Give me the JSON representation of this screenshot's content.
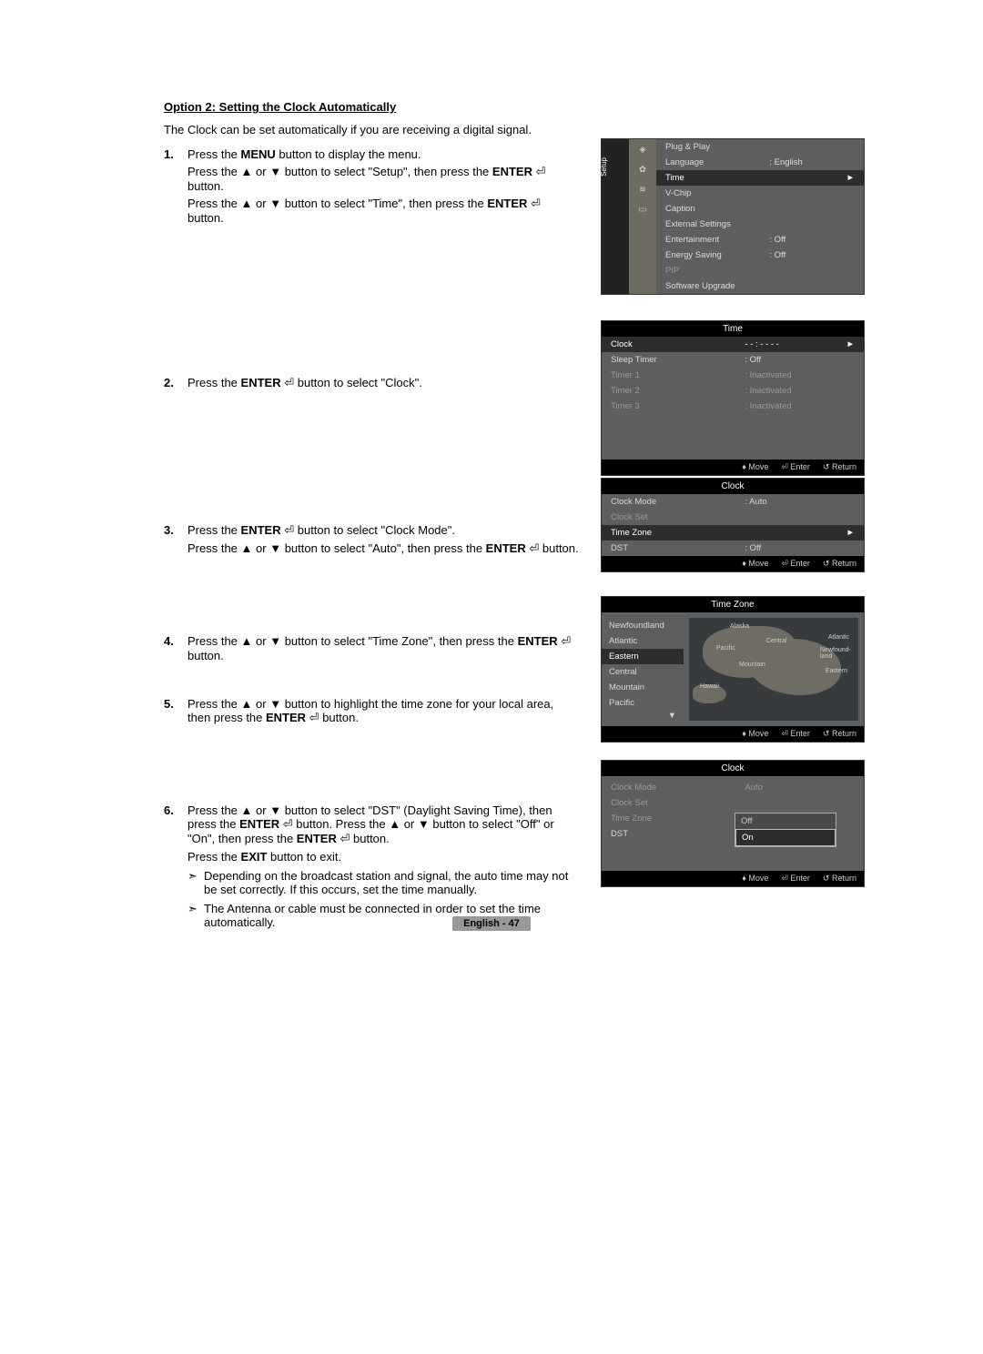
{
  "title": "Option 2: Setting the Clock Automatically",
  "intro": "The Clock can be set automatically if you are receiving a digital signal.",
  "bold": {
    "menu": "MENU",
    "enter": "ENTER",
    "exit": "EXIT"
  },
  "glyph": {
    "up": "▲",
    "down": "▼",
    "updown": "♦",
    "enter_icon": "⏎",
    "return_icon": "↺",
    "arrow_r": "►",
    "note": "➣"
  },
  "steps": {
    "1": {
      "a_pre": "Press the ",
      "a_post": " button to display the menu.",
      "b_pre": "Press the ",
      "b_mid": " or ",
      "b_mid2": " button to select \"Setup\", then press the ",
      "b_post": " button.",
      "c_pre": "Press the ",
      "c_mid": " or ",
      "c_mid2": " button to select \"Time\", then press the ",
      "c_post": " button."
    },
    "2": {
      "pre": "Press the ",
      "post": " button to select \"Clock\"."
    },
    "3": {
      "a_pre": "Press the ",
      "a_post": " button to select \"Clock Mode\".",
      "b_pre": "Press the ",
      "b_mid": " or ",
      "b_mid2": " button to select \"Auto\", then press the ",
      "b_post": " button."
    },
    "4": {
      "pre": "Press the ",
      "mid": " or ",
      "mid2": " button to select \"Time Zone\", then press the ",
      "post": " button."
    },
    "5": {
      "pre": "Press the ",
      "mid": " or ",
      "mid2": " button to highlight the time zone for your local area, then press the ",
      "post": " button."
    },
    "6": {
      "a_pre": "Press the ",
      "a_mid": " or ",
      "a_mid2": " button to select \"DST\" (Daylight Saving Time), then press the ",
      "a_mid3": " button. Press the ",
      "a_mid4": " or ",
      "a_mid5": " button to select \"Off\" or \"On\", then press the ",
      "a_post": " button.",
      "b_pre": "Press the ",
      "b_post": " button to exit.",
      "note1": "Depending on the broadcast station and signal, the auto time may not be set correctly. If this occurs, set the time manually.",
      "note2": "The Antenna or cable must be connected in order to set the time automatically."
    }
  },
  "osd_setup": {
    "sidebar_label": "Setup",
    "items": [
      {
        "label": "Plug & Play",
        "val": ""
      },
      {
        "label": "Language",
        "val": ": English"
      },
      {
        "label": "Time",
        "val": "",
        "sel": true,
        "arrow": true
      },
      {
        "label": "V-Chip",
        "val": ""
      },
      {
        "label": "Caption",
        "val": ""
      },
      {
        "label": "External Settings",
        "val": ""
      },
      {
        "label": "Entertainment",
        "val": ": Off"
      },
      {
        "label": "Energy Saving",
        "val": ": Off"
      },
      {
        "label": "PIP",
        "val": "",
        "dim": true
      },
      {
        "label": "Software Upgrade",
        "val": ""
      }
    ]
  },
  "osd_time": {
    "title": "Time",
    "items": [
      {
        "label": "Clock",
        "val": "- - : - - - -",
        "sel": true,
        "arrow": true
      },
      {
        "label": "Sleep Timer",
        "val": ": Off"
      },
      {
        "label": "Timer 1",
        "val": ": Inactivated",
        "dim": true
      },
      {
        "label": "Timer 2",
        "val": ": Inactivated",
        "dim": true
      },
      {
        "label": "Timer 3",
        "val": ": Inactivated",
        "dim": true
      }
    ],
    "footer": {
      "move": "Move",
      "enter": "Enter",
      "return": "Return"
    }
  },
  "osd_clock": {
    "title": "Clock",
    "items": [
      {
        "label": "Clock Mode",
        "val": ": Auto"
      },
      {
        "label": "Clock Set",
        "val": "",
        "dim": true
      },
      {
        "label": "Time Zone",
        "val": "",
        "sel": true,
        "arrow": true
      },
      {
        "label": "DST",
        "val": ": Off"
      }
    ],
    "footer": {
      "move": "Move",
      "enter": "Enter",
      "return": "Return"
    }
  },
  "osd_timezone": {
    "title": "Time Zone",
    "list": [
      "Newfoundland",
      "Atlantic",
      "Eastern",
      "Central",
      "Mountain",
      "Pacific"
    ],
    "selected_index": 2,
    "map_labels": [
      "Alaska",
      "Pacific",
      "Mountain",
      "Central",
      "Atlantic",
      "Eastern",
      "Newfound-land",
      "Hawaii"
    ],
    "footer": {
      "move": "Move",
      "enter": "Enter",
      "return": "Return"
    }
  },
  "osd_dst": {
    "title": "Clock",
    "items": [
      {
        "label": "Clock Mode",
        "val": "Auto",
        "dim": true
      },
      {
        "label": "Clock Set",
        "val": "",
        "dim": true
      },
      {
        "label": "Time Zone",
        "val": "",
        "dim": true
      },
      {
        "label": "DST",
        "val": ""
      }
    ],
    "options": [
      "Off",
      "On"
    ],
    "selected_index": 1,
    "footer": {
      "move": "Move",
      "enter": "Enter",
      "return": "Return"
    }
  },
  "page_num": "English - 47"
}
